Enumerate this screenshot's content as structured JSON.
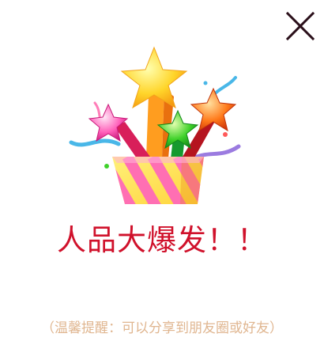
{
  "dialog": {
    "headline": "人品大爆发！！",
    "tip": "（温馨提醒：可以分享到朋友圈或好友）"
  },
  "icons": {
    "close": "close-icon",
    "illustration": "gift-box-stars-icon"
  },
  "colors": {
    "headline": "#d0112b",
    "tip": "#e0b690",
    "close": "#2a0f1a"
  }
}
